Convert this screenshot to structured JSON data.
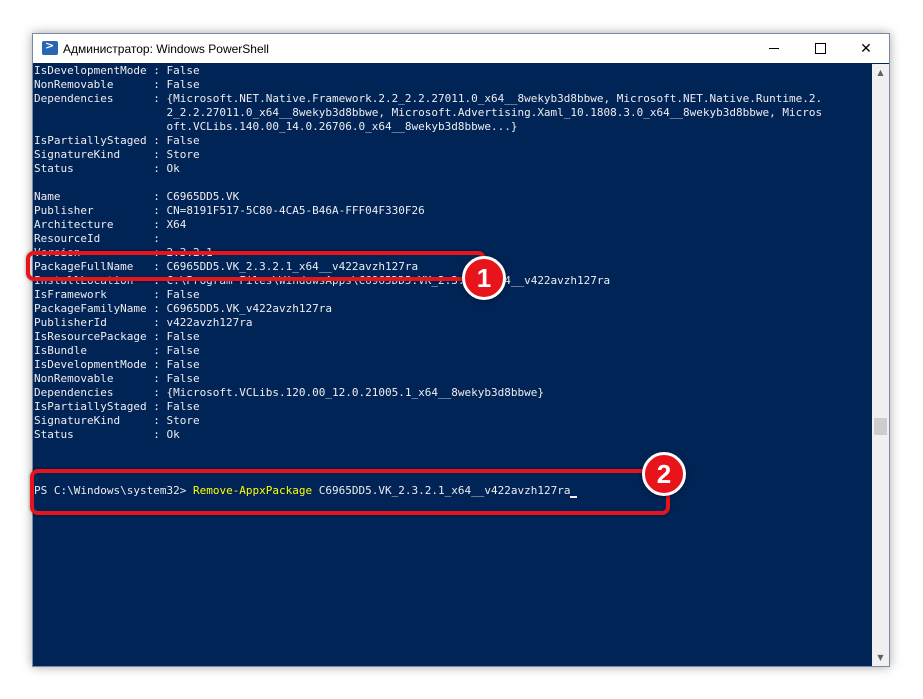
{
  "window": {
    "title": "Администратор: Windows PowerShell"
  },
  "console": {
    "lines": [
      "IsDevelopmentMode : False",
      "NonRemovable      : False",
      "Dependencies      : {Microsoft.NET.Native.Framework.2.2_2.2.27011.0_x64__8wekyb3d8bbwe, Microsoft.NET.Native.Runtime.2.",
      "                    2_2.2.27011.0_x64__8wekyb3d8bbwe, Microsoft.Advertising.Xaml_10.1808.3.0_x64__8wekyb3d8bbwe, Micros",
      "                    oft.VCLibs.140.00_14.0.26706.0_x64__8wekyb3d8bbwe...}",
      "IsPartiallyStaged : False",
      "SignatureKind     : Store",
      "Status            : Ok",
      "",
      "Name              : C6965DD5.VK",
      "Publisher         : CN=8191F517-5C80-4CA5-B46A-FFF04F330F26",
      "Architecture      : X64",
      "ResourceId        :",
      "Version           : 2.3.2.1",
      "PackageFullName   : C6965DD5.VK_2.3.2.1_x64__v422avzh127ra",
      "InstallLocation   : C:\\Program Files\\WindowsApps\\C6965DD5.VK_2.3.2.1_x64__v422avzh127ra",
      "IsFramework       : False",
      "PackageFamilyName : C6965DD5.VK_v422avzh127ra",
      "PublisherId       : v422avzh127ra",
      "IsResourcePackage : False",
      "IsBundle          : False",
      "IsDevelopmentMode : False",
      "NonRemovable      : False",
      "Dependencies      : {Microsoft.VCLibs.120.00_12.0.21005.1_x64__8wekyb3d8bbwe}",
      "IsPartiallyStaged : False",
      "SignatureKind     : Store",
      "Status            : Ok",
      "",
      "",
      ""
    ],
    "prompt": "PS C:\\Windows\\system32> ",
    "command": "Remove-AppxPackage",
    "argument": " C6965DD5.VK_2.3.2.1_x64__v422avzh127ra"
  },
  "annotations": {
    "badge_1": "1",
    "badge_2": "2"
  },
  "colors": {
    "console_background": "#012456",
    "console_text": "#eeedf0",
    "command_text": "#ffff00",
    "highlight": "#e8141c"
  }
}
